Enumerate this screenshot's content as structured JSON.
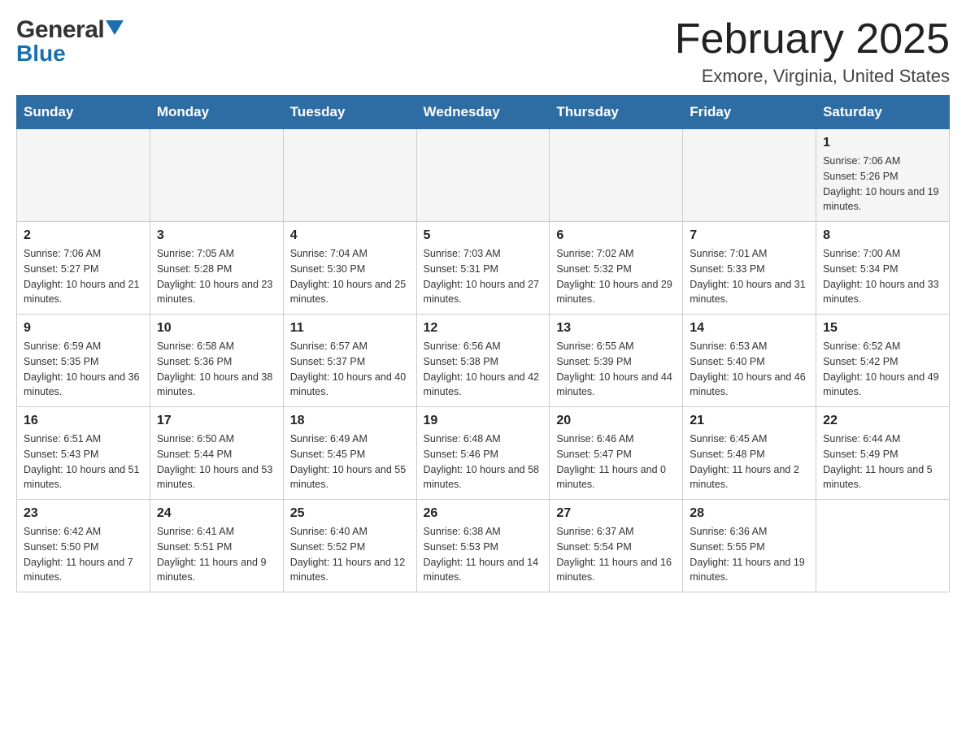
{
  "header": {
    "logo_general": "General",
    "logo_blue": "Blue",
    "month_year": "February 2025",
    "location": "Exmore, Virginia, United States"
  },
  "days_of_week": [
    "Sunday",
    "Monday",
    "Tuesday",
    "Wednesday",
    "Thursday",
    "Friday",
    "Saturday"
  ],
  "weeks": [
    [
      {
        "day": "",
        "sunrise": "",
        "sunset": "",
        "daylight": ""
      },
      {
        "day": "",
        "sunrise": "",
        "sunset": "",
        "daylight": ""
      },
      {
        "day": "",
        "sunrise": "",
        "sunset": "",
        "daylight": ""
      },
      {
        "day": "",
        "sunrise": "",
        "sunset": "",
        "daylight": ""
      },
      {
        "day": "",
        "sunrise": "",
        "sunset": "",
        "daylight": ""
      },
      {
        "day": "",
        "sunrise": "",
        "sunset": "",
        "daylight": ""
      },
      {
        "day": "1",
        "sunrise": "Sunrise: 7:06 AM",
        "sunset": "Sunset: 5:26 PM",
        "daylight": "Daylight: 10 hours and 19 minutes."
      }
    ],
    [
      {
        "day": "2",
        "sunrise": "Sunrise: 7:06 AM",
        "sunset": "Sunset: 5:27 PM",
        "daylight": "Daylight: 10 hours and 21 minutes."
      },
      {
        "day": "3",
        "sunrise": "Sunrise: 7:05 AM",
        "sunset": "Sunset: 5:28 PM",
        "daylight": "Daylight: 10 hours and 23 minutes."
      },
      {
        "day": "4",
        "sunrise": "Sunrise: 7:04 AM",
        "sunset": "Sunset: 5:30 PM",
        "daylight": "Daylight: 10 hours and 25 minutes."
      },
      {
        "day": "5",
        "sunrise": "Sunrise: 7:03 AM",
        "sunset": "Sunset: 5:31 PM",
        "daylight": "Daylight: 10 hours and 27 minutes."
      },
      {
        "day": "6",
        "sunrise": "Sunrise: 7:02 AM",
        "sunset": "Sunset: 5:32 PM",
        "daylight": "Daylight: 10 hours and 29 minutes."
      },
      {
        "day": "7",
        "sunrise": "Sunrise: 7:01 AM",
        "sunset": "Sunset: 5:33 PM",
        "daylight": "Daylight: 10 hours and 31 minutes."
      },
      {
        "day": "8",
        "sunrise": "Sunrise: 7:00 AM",
        "sunset": "Sunset: 5:34 PM",
        "daylight": "Daylight: 10 hours and 33 minutes."
      }
    ],
    [
      {
        "day": "9",
        "sunrise": "Sunrise: 6:59 AM",
        "sunset": "Sunset: 5:35 PM",
        "daylight": "Daylight: 10 hours and 36 minutes."
      },
      {
        "day": "10",
        "sunrise": "Sunrise: 6:58 AM",
        "sunset": "Sunset: 5:36 PM",
        "daylight": "Daylight: 10 hours and 38 minutes."
      },
      {
        "day": "11",
        "sunrise": "Sunrise: 6:57 AM",
        "sunset": "Sunset: 5:37 PM",
        "daylight": "Daylight: 10 hours and 40 minutes."
      },
      {
        "day": "12",
        "sunrise": "Sunrise: 6:56 AM",
        "sunset": "Sunset: 5:38 PM",
        "daylight": "Daylight: 10 hours and 42 minutes."
      },
      {
        "day": "13",
        "sunrise": "Sunrise: 6:55 AM",
        "sunset": "Sunset: 5:39 PM",
        "daylight": "Daylight: 10 hours and 44 minutes."
      },
      {
        "day": "14",
        "sunrise": "Sunrise: 6:53 AM",
        "sunset": "Sunset: 5:40 PM",
        "daylight": "Daylight: 10 hours and 46 minutes."
      },
      {
        "day": "15",
        "sunrise": "Sunrise: 6:52 AM",
        "sunset": "Sunset: 5:42 PM",
        "daylight": "Daylight: 10 hours and 49 minutes."
      }
    ],
    [
      {
        "day": "16",
        "sunrise": "Sunrise: 6:51 AM",
        "sunset": "Sunset: 5:43 PM",
        "daylight": "Daylight: 10 hours and 51 minutes."
      },
      {
        "day": "17",
        "sunrise": "Sunrise: 6:50 AM",
        "sunset": "Sunset: 5:44 PM",
        "daylight": "Daylight: 10 hours and 53 minutes."
      },
      {
        "day": "18",
        "sunrise": "Sunrise: 6:49 AM",
        "sunset": "Sunset: 5:45 PM",
        "daylight": "Daylight: 10 hours and 55 minutes."
      },
      {
        "day": "19",
        "sunrise": "Sunrise: 6:48 AM",
        "sunset": "Sunset: 5:46 PM",
        "daylight": "Daylight: 10 hours and 58 minutes."
      },
      {
        "day": "20",
        "sunrise": "Sunrise: 6:46 AM",
        "sunset": "Sunset: 5:47 PM",
        "daylight": "Daylight: 11 hours and 0 minutes."
      },
      {
        "day": "21",
        "sunrise": "Sunrise: 6:45 AM",
        "sunset": "Sunset: 5:48 PM",
        "daylight": "Daylight: 11 hours and 2 minutes."
      },
      {
        "day": "22",
        "sunrise": "Sunrise: 6:44 AM",
        "sunset": "Sunset: 5:49 PM",
        "daylight": "Daylight: 11 hours and 5 minutes."
      }
    ],
    [
      {
        "day": "23",
        "sunrise": "Sunrise: 6:42 AM",
        "sunset": "Sunset: 5:50 PM",
        "daylight": "Daylight: 11 hours and 7 minutes."
      },
      {
        "day": "24",
        "sunrise": "Sunrise: 6:41 AM",
        "sunset": "Sunset: 5:51 PM",
        "daylight": "Daylight: 11 hours and 9 minutes."
      },
      {
        "day": "25",
        "sunrise": "Sunrise: 6:40 AM",
        "sunset": "Sunset: 5:52 PM",
        "daylight": "Daylight: 11 hours and 12 minutes."
      },
      {
        "day": "26",
        "sunrise": "Sunrise: 6:38 AM",
        "sunset": "Sunset: 5:53 PM",
        "daylight": "Daylight: 11 hours and 14 minutes."
      },
      {
        "day": "27",
        "sunrise": "Sunrise: 6:37 AM",
        "sunset": "Sunset: 5:54 PM",
        "daylight": "Daylight: 11 hours and 16 minutes."
      },
      {
        "day": "28",
        "sunrise": "Sunrise: 6:36 AM",
        "sunset": "Sunset: 5:55 PM",
        "daylight": "Daylight: 11 hours and 19 minutes."
      },
      {
        "day": "",
        "sunrise": "",
        "sunset": "",
        "daylight": ""
      }
    ]
  ]
}
